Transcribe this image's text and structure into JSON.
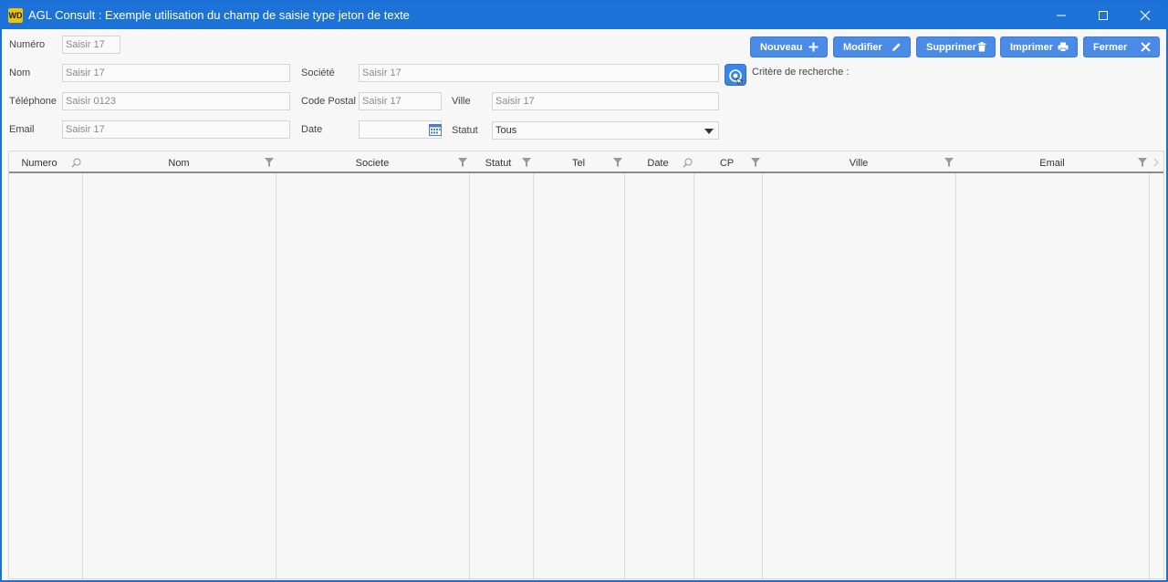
{
  "window": {
    "app_icon_text": "WD",
    "title": "AGL Consult : Exemple utilisation du champ de saisie type jeton de texte"
  },
  "form": {
    "numero": {
      "label": "Numéro",
      "placeholder": "Saisir 17"
    },
    "nom": {
      "label": "Nom",
      "placeholder": "Saisir 17"
    },
    "societe": {
      "label": "Société",
      "placeholder": "Saisir 17"
    },
    "telephone": {
      "label": "Téléphone",
      "placeholder": "Saisir 0123"
    },
    "code_postal": {
      "label": "Code Postal",
      "placeholder": "Saisir 17"
    },
    "ville": {
      "label": "Ville",
      "placeholder": "Saisir 17"
    },
    "email": {
      "label": "Email",
      "placeholder": "Saisir 17"
    },
    "date": {
      "label": "Date",
      "value": ""
    },
    "statut": {
      "label": "Statut",
      "value": "Tous"
    },
    "critere_label": "Critère de recherche :"
  },
  "toolbar": {
    "nouveau": "Nouveau",
    "modifier": "Modifier",
    "supprimer": "Supprimer",
    "imprimer": "Imprimer",
    "fermer": "Fermer"
  },
  "table": {
    "columns": [
      "Numero",
      "Nom",
      "Societe",
      "Statut",
      "Tel",
      "Date",
      "CP",
      "Ville",
      "Email"
    ],
    "column_icons": [
      "search-icon",
      "filter-icon",
      "filter-icon",
      "filter-icon",
      "filter-icon",
      "search-icon",
      "filter-icon",
      "filter-icon",
      "filter-icon"
    ],
    "rows": []
  },
  "colors": {
    "title_bar": "#1d72d8",
    "button": "#4a8be6",
    "background": "#f7f7f7"
  }
}
